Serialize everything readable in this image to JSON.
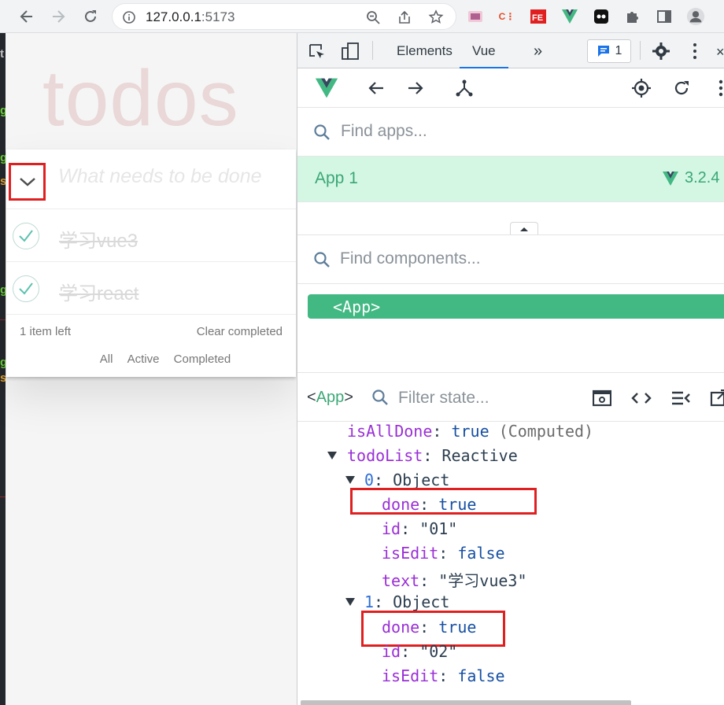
{
  "browser": {
    "url_host": "127.0.0.1",
    "url_port": ":5173",
    "extensions": [
      "reader-ext-icon",
      "cs-ext-icon",
      "fe-ext-icon",
      "vue-ext-icon",
      "dark-ext-icon",
      "puzzle-icon",
      "sidepanel-icon",
      "avatar-icon"
    ]
  },
  "todo_app": {
    "title": "todos",
    "new_placeholder": "What needs to be done",
    "items": [
      {
        "text": "学习vue3",
        "done": true
      },
      {
        "text": "学习react",
        "done": true
      }
    ],
    "items_left": "1 item left",
    "clear_completed": "Clear completed",
    "filters": [
      "All",
      "Active",
      "Completed"
    ]
  },
  "devtools": {
    "tabs": {
      "elements": "Elements",
      "vue": "Vue"
    },
    "message_count": "1",
    "find_apps_placeholder": "Find apps...",
    "app_name": "App 1",
    "app_version": "3.2.4",
    "find_components_placeholder": "Find components...",
    "component": "<App>",
    "state_tag_open": "<",
    "state_tag_name": "App",
    "state_tag_close": ">",
    "filter_state_placeholder": "Filter state...",
    "state": {
      "isAllDone_key": "isAllDone",
      "isAllDone_val": "true",
      "computed": "(Computed)",
      "todoList_key": "todoList",
      "todoList_type": "Reactive",
      "item0_index": "0",
      "item1_index": "1",
      "object_type": "Object",
      "done_key": "done",
      "done_val": "true",
      "id_key": "id",
      "id0_val": "\"01\"",
      "id1_val": "\"02\"",
      "isEdit_key": "isEdit",
      "isEdit_val": "false",
      "text_key": "text",
      "text0_val": "\"学习vue3\""
    }
  }
}
